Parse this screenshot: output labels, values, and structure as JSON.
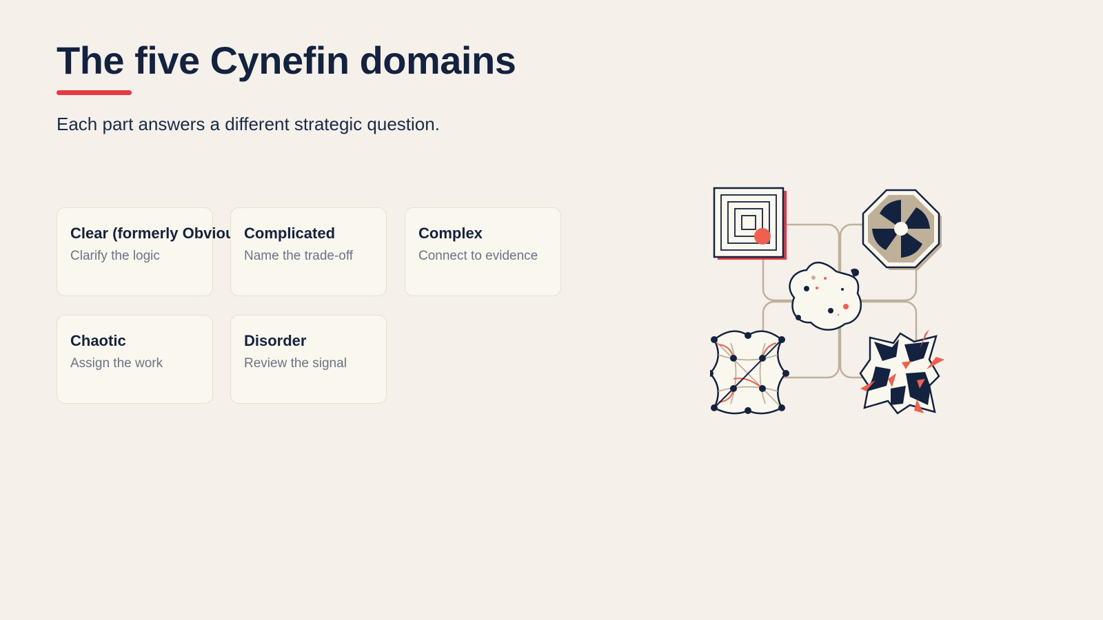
{
  "slide": {
    "title": "The five Cynefin domains",
    "subtitle": "Each part answers a different strategic question."
  },
  "domains": [
    {
      "name": "Clear (formerly Obvious)",
      "description": "Clarify the logic"
    },
    {
      "name": "Complicated",
      "description": "Name the trade-off"
    },
    {
      "name": "Complex",
      "description": "Connect to evidence"
    },
    {
      "name": "Chaotic",
      "description": "Assign the work"
    },
    {
      "name": "Disorder",
      "description": "Review the signal"
    }
  ],
  "colors": {
    "background": "#f5f1ea",
    "navy": "#12223f",
    "accent": "#e63946",
    "coral": "#f0604f",
    "taupe": "#bfb09a",
    "card": "#faf7ee"
  },
  "icons": [
    "labyrinth-icon",
    "pinwheel-octagon-icon",
    "blob-icon",
    "network-icon",
    "shatter-icon"
  ]
}
